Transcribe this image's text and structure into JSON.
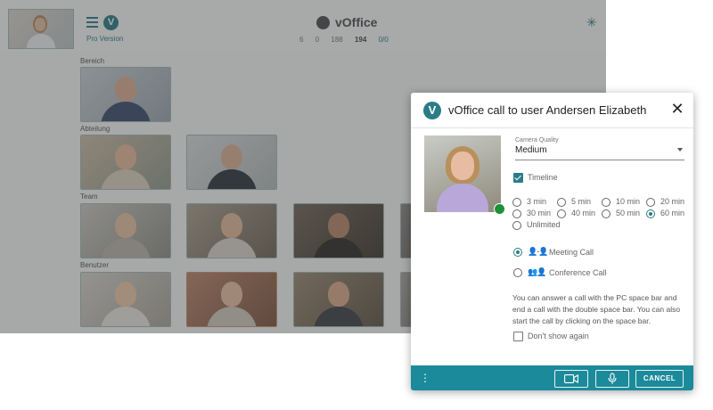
{
  "app": {
    "title": "vOffice",
    "pro_version": "Pro Version",
    "stats": [
      "6",
      "0",
      "188",
      "194",
      "0/0"
    ],
    "sections": {
      "bereich": "Bereich",
      "abteilung": "Abteilung",
      "team": "Team",
      "benutzer": "Benutzer"
    },
    "icons": {
      "menu": "menu-icon",
      "logo": "voffice-logo",
      "globe": "globe-icon",
      "status": "sparkle-icon"
    }
  },
  "dialog": {
    "logo_letter": "V",
    "title": "vOffice call to user Andersen Elizabeth",
    "close": "✕",
    "camera_quality_label": "Camera Quality",
    "camera_quality_value": "Medium",
    "timeline_label": "Timeline",
    "timeline_checked": true,
    "durations": [
      "3 min",
      "5 min",
      "10 min",
      "20 min",
      "30 min",
      "40 min",
      "50 min",
      "60 min",
      "Unlimited"
    ],
    "selected_duration": "60 min",
    "call_types": [
      "Meeting Call",
      "Conference Call"
    ],
    "selected_call_type": "Meeting Call",
    "help_text": "You can answer a call with the PC space bar and end a call with the double space bar. You can also start the call by clicking on the space bar.",
    "dont_show_label": "Don't show again",
    "dont_show_checked": false,
    "footer": {
      "more": "⋮",
      "video_icon": "video-camera-icon",
      "mic_icon": "microphone-icon",
      "cancel": "CANCEL"
    }
  },
  "colors": {
    "accent": "#2a7c87",
    "footer": "#1b8a9a",
    "online": "#1f8f3a"
  }
}
